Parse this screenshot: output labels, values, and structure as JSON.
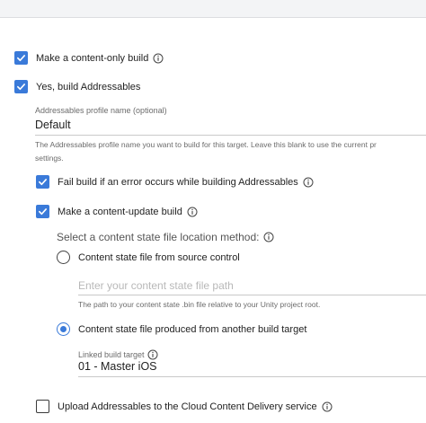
{
  "content_only_build": {
    "label": "Make a content-only build",
    "checked": true,
    "info_icon": "info-icon"
  },
  "build_addressables": {
    "label": "Yes, build Addressables",
    "checked": true
  },
  "profile": {
    "label": "Addressables profile name (optional)",
    "value": "Default",
    "help_line1": "The Addressables profile name you want to build for this target. Leave this blank to use the current pr",
    "help_line2": "settings."
  },
  "fail_build": {
    "label": "Fail build if an error occurs while building Addressables",
    "checked": true
  },
  "content_update": {
    "label": "Make a content-update build",
    "checked": true
  },
  "location_method": {
    "question": "Select a content state file location method:",
    "option_source_control": {
      "label": "Content state file from source control",
      "selected": false
    },
    "path_placeholder": "Enter your content state file path",
    "path_help": "The path to your content state .bin file relative to your Unity project root.",
    "option_other_target": {
      "label": "Content state file produced from another build target",
      "selected": true
    },
    "linked_target_label": "Linked build target",
    "linked_target_value": "01 - Master iOS"
  },
  "upload_ccd": {
    "label": "Upload Addressables to the Cloud Content Delivery service",
    "checked": false
  },
  "colors": {
    "accent": "#3a7ad9",
    "muted_text": "#6b6b6b"
  }
}
